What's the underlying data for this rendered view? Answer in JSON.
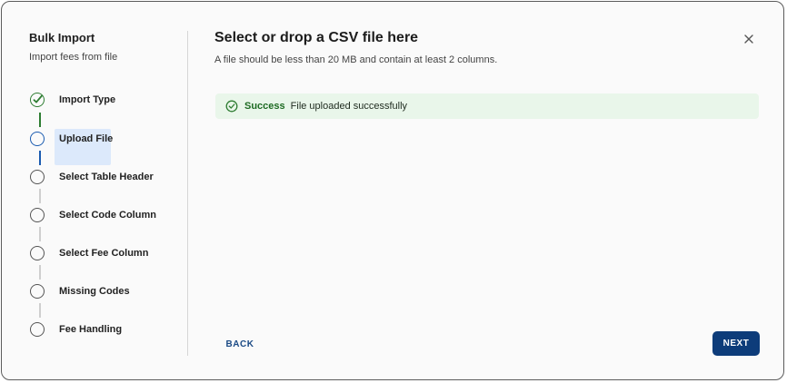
{
  "sidebar": {
    "title": "Bulk Import",
    "subtitle": "Import fees from file",
    "steps": [
      {
        "label": "Import Type",
        "status": "complete"
      },
      {
        "label": "Upload File",
        "status": "active"
      },
      {
        "label": "Select Table Header",
        "status": "pending"
      },
      {
        "label": "Select Code Column",
        "status": "pending"
      },
      {
        "label": "Select Fee Column",
        "status": "pending"
      },
      {
        "label": "Missing Codes",
        "status": "pending"
      },
      {
        "label": "Fee Handling",
        "status": "pending"
      }
    ]
  },
  "main": {
    "title": "Select or drop a CSV file here",
    "subtitle": "A file should be less than 20 MB and contain at least 2 columns.",
    "alert": {
      "strong": "Success",
      "text": "File uploaded successfully",
      "icon": "check-circle-icon"
    }
  },
  "footer": {
    "back_label": "BACK",
    "next_label": "NEXT"
  },
  "colors": {
    "success": "#2e7d32",
    "active": "#1a5bb0",
    "primary_button": "#0d3c7a",
    "alert_bg": "#e9f6ea"
  }
}
